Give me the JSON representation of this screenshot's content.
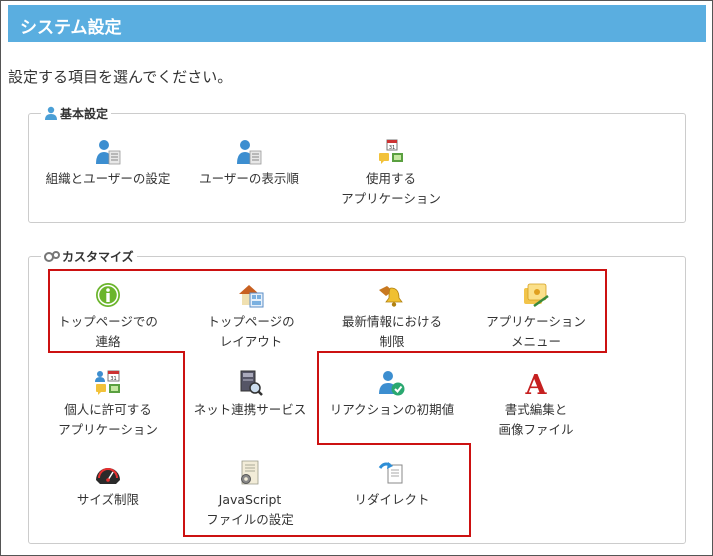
{
  "page_title": "システム設定",
  "intro": "設定する項目を選んでください。",
  "basic": {
    "legend": "基本設定",
    "items": [
      {
        "label": "組織とユーザーの設定",
        "icon": "user-list-icon"
      },
      {
        "label": "ユーザーの表示順",
        "icon": "user-order-icon"
      },
      {
        "label": "使用する\nアプリケーション",
        "icon": "applications-icon"
      }
    ]
  },
  "custom": {
    "legend": "カスタマイズ",
    "items": [
      {
        "label": "トップページでの\n連絡",
        "icon": "info-icon"
      },
      {
        "label": "トップページの\nレイアウト",
        "icon": "house-layout-icon"
      },
      {
        "label": "最新情報における\n制限",
        "icon": "bell-restriction-icon"
      },
      {
        "label": "アプリケーション\nメニュー",
        "icon": "app-menu-icon"
      },
      {
        "label": "個人に許可する\nアプリケーション",
        "icon": "personal-apps-icon"
      },
      {
        "label": "ネット連携サービス",
        "icon": "net-service-icon"
      },
      {
        "label": "リアクションの初期値",
        "icon": "reaction-icon"
      },
      {
        "label": "書式編集と\n画像ファイル",
        "icon": "format-a-icon"
      },
      {
        "label": "サイズ制限",
        "icon": "gauge-icon"
      },
      {
        "label": "JavaScript\nファイルの設定",
        "icon": "script-file-icon"
      },
      {
        "label": "リダイレクト",
        "icon": "redirect-icon"
      }
    ]
  },
  "colors": {
    "header": "#5aaee0",
    "highlight": "#cc1111"
  }
}
